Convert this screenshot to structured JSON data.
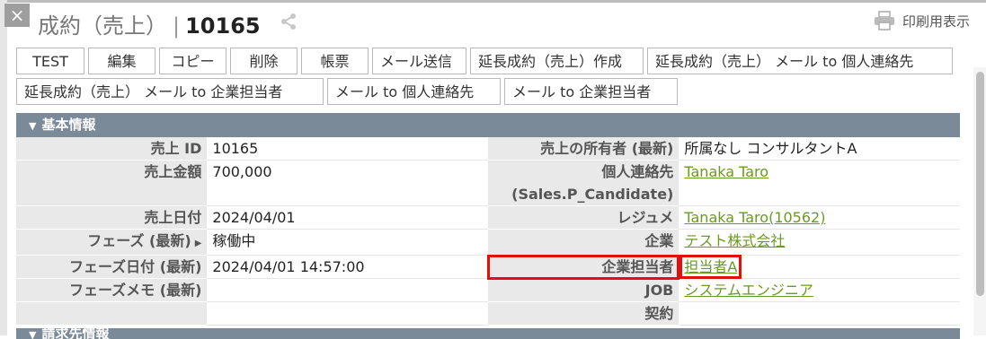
{
  "window": {
    "close_glyph": "×"
  },
  "header": {
    "title": "成約（売上）",
    "separator": "|",
    "record_number": "10165",
    "print_label": "印刷用表示"
  },
  "toolbar": {
    "row1": [
      "TEST",
      "編集",
      "コピー",
      "削除",
      "帳票",
      "メール送信",
      "延長成約（売上）作成",
      "延長成約（売上） メール to 個人連絡先"
    ],
    "row2": [
      "延長成約（売上） メール to 企業担当者",
      "メール to 個人連絡先",
      "メール to 企業担当者"
    ]
  },
  "section": {
    "title": "基本情報",
    "next_title": "請求先情報"
  },
  "fields": {
    "sales_id_label": "売上 ID",
    "sales_id": "10165",
    "owner_label": "売上の所有者 (最新)",
    "owner": "所属なし コンサルタントA",
    "amount_label": "売上金額",
    "amount": "700,000",
    "candidate_label_1": "個人連絡先",
    "candidate_label_2": "(Sales.P_Candidate)",
    "candidate": "Tanaka Taro",
    "sales_date_label": "売上日付",
    "sales_date": "2024/04/01",
    "resume_label": "レジュメ",
    "resume": "Tanaka Taro(10562)",
    "phase_label": "フェーズ (最新)",
    "phase": "稼働中",
    "company_label": "企業",
    "company": "テスト株式会社",
    "phase_date_label": "フェーズ日付 (最新)",
    "phase_date": "2024/04/01 14:57:00",
    "company_contact_label": "企業担当者",
    "company_contact": "担当者A",
    "phase_memo_label": "フェーズメモ (最新)",
    "phase_memo": "",
    "job_label": "JOB",
    "job": "システムエンジニア",
    "contract_label": "契約",
    "contract": ""
  }
}
